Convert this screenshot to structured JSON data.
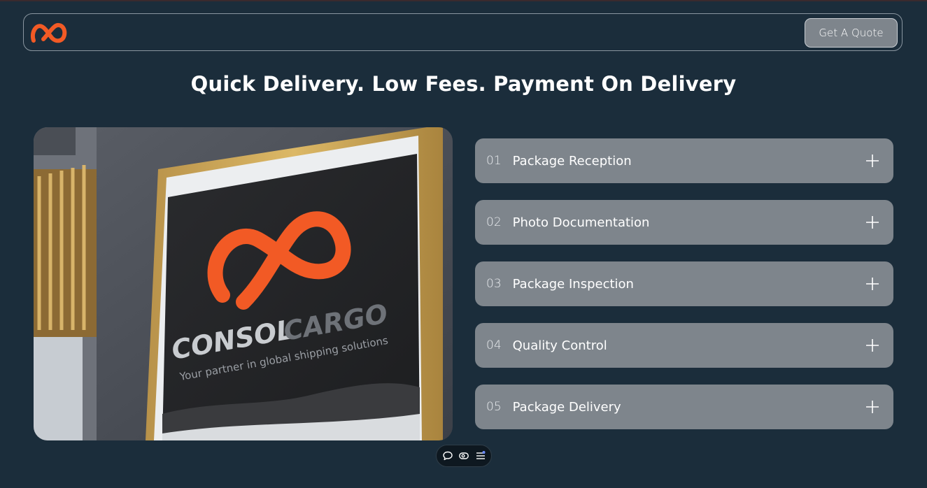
{
  "brand": {
    "logo_icon": "infinity-wave-logo",
    "accent_color": "#f25a25"
  },
  "navbar": {
    "quote_button_label": "Get A Quote"
  },
  "hero": {
    "headline": "Quick Delivery. Low Fees. Payment On Delivery",
    "billboard_brand_word1": "CONSOL",
    "billboard_brand_word2": "CARGO",
    "billboard_tagline": "Your partner in global shipping solutions"
  },
  "steps": [
    {
      "number": "01",
      "title": "Package Reception"
    },
    {
      "number": "02",
      "title": "Photo Documentation"
    },
    {
      "number": "03",
      "title": "Package Inspection"
    },
    {
      "number": "04",
      "title": "Quality Control"
    },
    {
      "number": "05",
      "title": "Package Delivery"
    }
  ],
  "toolbar": {
    "icons": [
      "comment-icon",
      "eye-icon",
      "sliders-icon"
    ]
  }
}
